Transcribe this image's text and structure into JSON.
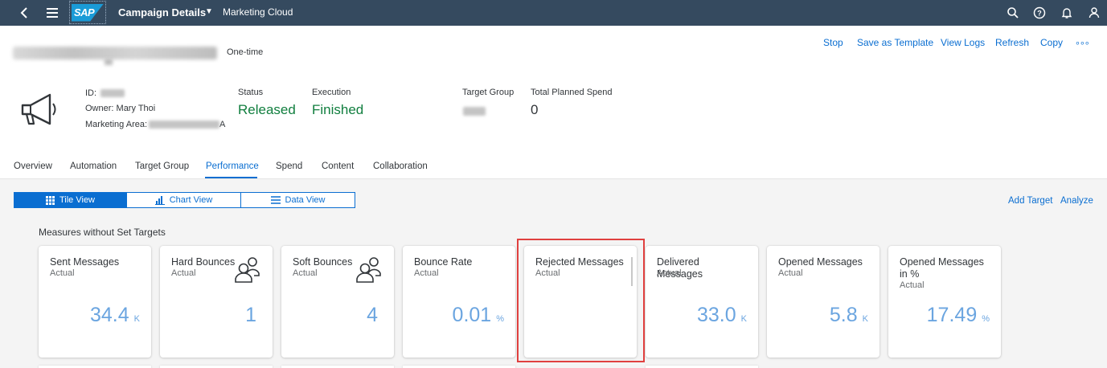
{
  "shell": {
    "logo_text": "SAP",
    "title": "Campaign Details",
    "subtitle": "Marketing Cloud",
    "icons": [
      "back-icon",
      "menu-icon",
      "search-icon",
      "help-icon",
      "bell-icon",
      "user-icon"
    ]
  },
  "header": {
    "type_label": "One-time",
    "actions": [
      "Stop",
      "Save as Template",
      "View Logs",
      "Refresh",
      "Copy"
    ],
    "id_label": "ID:",
    "owner_label": "Owner:",
    "owner_value": "Mary Thoi",
    "area_label": "Marketing Area:",
    "area_value_suffix": "A",
    "status_label": "Status",
    "status_value": "Released",
    "execution_label": "Execution",
    "execution_value": "Finished",
    "target_group_label": "Target Group",
    "spend_label": "Total Planned Spend",
    "spend_value": "0"
  },
  "tabs": [
    "Overview",
    "Automation",
    "Target Group",
    "Performance",
    "Spend",
    "Content",
    "Collaboration"
  ],
  "active_tab": "Performance",
  "views": {
    "tile": "Tile View",
    "chart": "Chart View",
    "data": "Data View"
  },
  "right_links": [
    "Add Target",
    "Analyze"
  ],
  "group_title": "Measures without Set Targets",
  "tiles": [
    {
      "title": "Sent Messages",
      "sub": "Actual",
      "value": "34.4",
      "unit": "K"
    },
    {
      "title": "Hard Bounces",
      "sub": "Actual",
      "value": "1",
      "unit": ""
    },
    {
      "title": "Soft Bounces",
      "sub": "Actual",
      "value": "4",
      "unit": ""
    },
    {
      "title": "Bounce Rate",
      "sub": "Actual",
      "value": "0.01",
      "unit": "%"
    },
    {
      "title": "Rejected Messages",
      "sub": "Actual",
      "value": "",
      "unit": ""
    },
    {
      "title": "Delivered Messages",
      "sub": "Actual",
      "value": "33.0",
      "unit": "K"
    },
    {
      "title": "Opened Messages",
      "sub": "Actual",
      "value": "5.8",
      "unit": "K"
    },
    {
      "title": "Opened Messages in %",
      "sub": "Actual",
      "value": "17.49",
      "unit": "%"
    }
  ],
  "colors": {
    "shell_bg": "#354a5f",
    "accent": "#0a6ed1",
    "positive": "#107e3e",
    "tile_value": "#6ba5e0",
    "highlight": "#e0403f"
  }
}
